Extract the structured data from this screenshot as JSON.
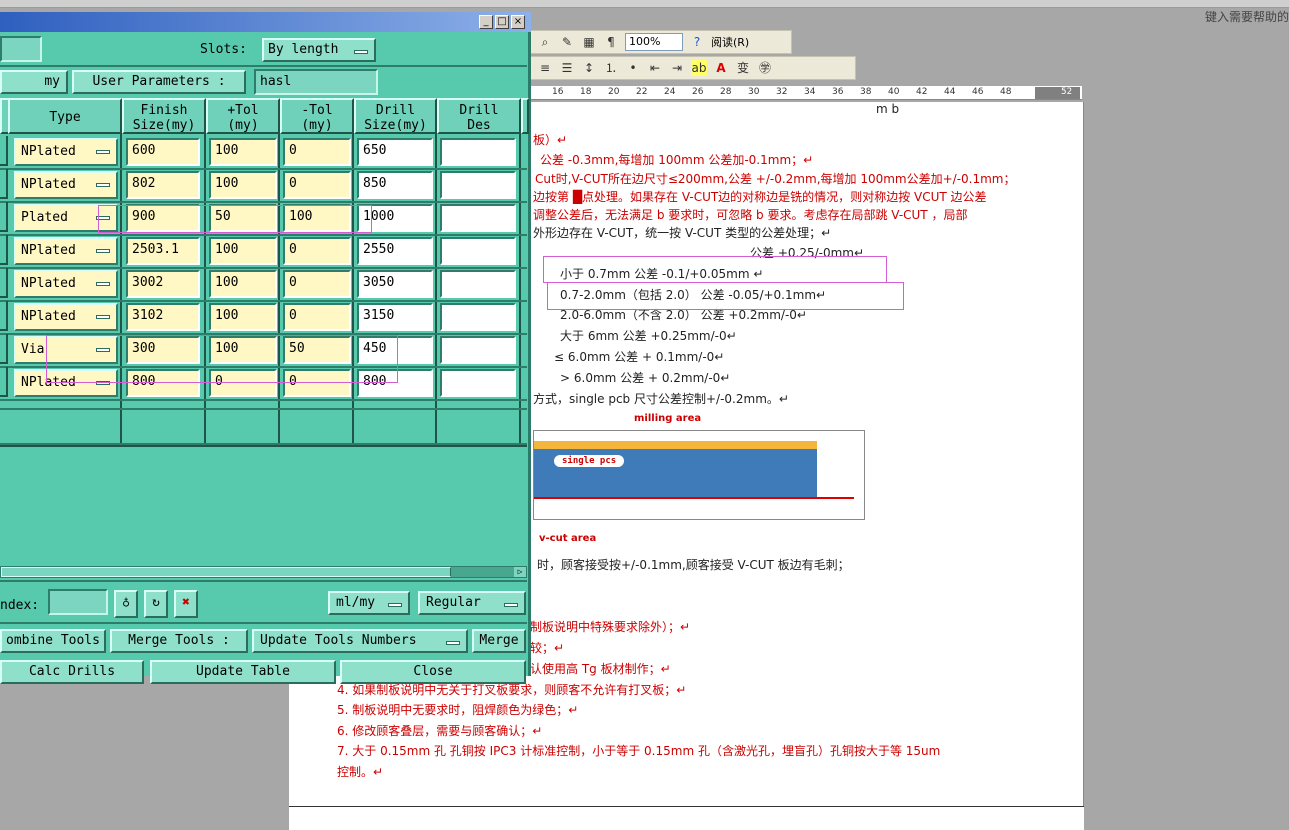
{
  "word": {
    "help_placeholder": "键入需要帮助的",
    "zoom": "100%",
    "read_button": "阅读(R)",
    "ruler_ticks": [
      "16",
      "18",
      "20",
      "22",
      "24",
      "26",
      "28",
      "30",
      "32",
      "34",
      "36",
      "38",
      "40",
      "42",
      "44",
      "46",
      "48",
      "52"
    ],
    "doc_lines": [
      {
        "text": "m      b",
        "color": "blk"
      },
      {
        "text": "板）↵",
        "color": "red"
      },
      {
        "text": "公差 -0.3mm,每增加 100mm 公差加-0.1mm；↵",
        "color": "red"
      },
      {
        "text": "Cut时,V-CUT所在边尺寸≤200mm,公差 +/-0.2mm,每增加 100mm公差加+/-0.1mm；",
        "color": "red"
      },
      {
        "text": "边按第 █点处理。如果存在 V-CUT边的对称边是铣的情况，则对称边按 VCUT 边公差",
        "color": "red"
      },
      {
        "text": "调整公差后，无法满足 b 要求时，可忽略 b 要求。考虑存在局部跳 V-CUT ，局部",
        "color": "red"
      },
      {
        "text": "外形边存在 V-CUT，统一按 V-CUT 类型的公差处理；↵",
        "color": "blk"
      },
      {
        "text": "公差 +0.25/-0mm↵",
        "color": "blk"
      },
      {
        "text": "小于 0.7mm                     公差 -0.1/+0.05mm  ↵",
        "color": "blk"
      },
      {
        "text": "0.7-2.0mm（包括 2.0）          公差  -0.05/+0.1mm↵",
        "color": "blk"
      },
      {
        "text": "2.0-6.0mm（不含 2.0）          公差 +0.2mm/-0↵",
        "color": "blk"
      },
      {
        "text": "大于 6mm                        公差 +0.25mm/-0↵",
        "color": "blk"
      },
      {
        "text": "≤ 6.0mm                         公差 + 0.1mm/-0↵",
        "color": "blk"
      },
      {
        "text": "> 6.0mm                         公差 + 0.2mm/-0↵",
        "color": "blk"
      },
      {
        "text": "方式，single pcb 尺寸公差控制+/-0.2mm。↵",
        "color": "blk"
      }
    ],
    "figure": {
      "milling": "milling area",
      "pcs": "single pcs",
      "vcut": "v-cut area"
    },
    "after_figure": "时，顾客接受按+/-0.1mm,顾客接受 V-CUT 板边有毛刺；",
    "list_lines": [
      {
        "text": "制板说明中特殊要求除外）；↵",
        "color": "red"
      },
      {
        "text": "较；↵",
        "color": "red"
      },
      {
        "text": "认使用高 Tg 板材制作；↵",
        "color": "red"
      },
      {
        "text": "4.   如果制板说明中无关于打叉板要求，则顾客不允许有打叉板；↵",
        "color": "red"
      },
      {
        "text": "5.   制板说明中无要求时，阻焊颜色为绿色；↵",
        "color": "red"
      },
      {
        "text": "6.   修改顾客叠层，需要与顾客确认；↵",
        "color": "red"
      },
      {
        "text": "7.   大于 0.15mm 孔 孔铜按 IPC3 计标准控制，小于等于 0.15mm 孔（含激光孔，埋盲孔）孔铜按大于等 15um",
        "color": "red"
      },
      {
        "text": "     控制。↵",
        "color": "red"
      }
    ]
  },
  "dialog": {
    "slots_label": "Slots:",
    "slots_value": "By length",
    "units_label": "my",
    "user_params_label": "User Parameters :",
    "user_params_value": "hasl",
    "columns": [
      "Type",
      "Finish\nSize(my)",
      "+Tol\n(my)",
      "-Tol\n(my)",
      "Drill\nSize(my)",
      "Drill\nDes"
    ],
    "rows": [
      {
        "type": "NPlated",
        "finish": "600",
        "ptol": "100",
        "ntol": "0",
        "drill": "650",
        "des": ""
      },
      {
        "type": "NPlated",
        "finish": "802",
        "ptol": "100",
        "ntol": "0",
        "drill": "850",
        "des": ""
      },
      {
        "type": "Plated",
        "finish": "900",
        "ptol": "50",
        "ntol": "100",
        "drill": "1000",
        "des": ""
      },
      {
        "type": "NPlated",
        "finish": "2503.1",
        "ptol": "100",
        "ntol": "0",
        "drill": "2550",
        "des": ""
      },
      {
        "type": "NPlated",
        "finish": "3002",
        "ptol": "100",
        "ntol": "0",
        "drill": "3050",
        "des": ""
      },
      {
        "type": "NPlated",
        "finish": "3102",
        "ptol": "100",
        "ntol": "0",
        "drill": "3150",
        "des": ""
      },
      {
        "type": "Via",
        "finish": "300",
        "ptol": "100",
        "ntol": "50",
        "drill": "450",
        "des": ""
      },
      {
        "type": "NPlated",
        "finish": "800",
        "ptol": "0",
        "ntol": "0",
        "drill": "800",
        "des": ""
      }
    ],
    "index_label": "ndex:",
    "units_select": "ml/my",
    "mode_select": "Regular",
    "combine_tools": "ombine Tools",
    "merge_tools_label": "Merge Tools :",
    "merge_tools_select": "Update Tools Numbers",
    "merge_button": "Merge",
    "calc_drills": "Calc Drills",
    "update_table": "Update Table",
    "close": "Close",
    "window_buttons": [
      "_",
      "□",
      "×"
    ]
  },
  "colors": {
    "dialog_bg": "#57c9ad",
    "cell_bg": "#fff8c4",
    "highlight": "#d45cd4",
    "doc_red": "#cc0000"
  }
}
